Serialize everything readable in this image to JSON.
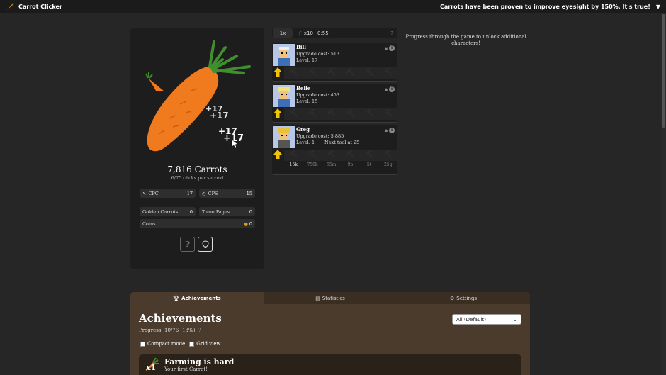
{
  "topbar": {
    "title": "Carrot Clicker",
    "tip": "Carrots have been proven to improve eyesight by 150%. It's true!"
  },
  "clicks": {
    "floating_labels": [
      "+17",
      "+17",
      "+17",
      "+17"
    ]
  },
  "main": {
    "carrot_count": "7,816 Carrots",
    "cps_line": "6/75 clicks per second",
    "stats": {
      "cpc_label": "CPC",
      "cpc_value": "17",
      "cps_label": "CPS",
      "cps_value": "15",
      "golden_label": "Golden Carrots",
      "golden_value": "0",
      "tome_label": "Tome Pages",
      "tome_value": "0",
      "coins_label": "Coins",
      "coins_value": "0"
    },
    "help_label": "?"
  },
  "toolbar": {
    "multiplier": "1x",
    "x10_label": "x10",
    "timer": "0:55",
    "help": "?"
  },
  "characters": [
    {
      "name": "Bill",
      "cost": "Upgrade cost: 513",
      "level": "Level: 17",
      "next_tool": ""
    },
    {
      "name": "Belle",
      "cost": "Upgrade cost: 453",
      "level": "Level: 15",
      "next_tool": ""
    },
    {
      "name": "Greg",
      "cost": "Upgrade cost: 5,885",
      "level": "Level: 1",
      "next_tool": "Next tool at 25"
    }
  ],
  "tool_prices": [
    "15k",
    "750k",
    "55m",
    "9b",
    "5t",
    "25q"
  ],
  "progress_note": "Progress through the game to unlock additional characters!",
  "bottom": {
    "tabs": [
      "Achievements",
      "Statistics",
      "Settings"
    ],
    "title": "Achievements",
    "progress": "Progress: 10/76 (13%)",
    "progress_help": "?",
    "filter_selected": "All (Default)",
    "compact_label": "Compact mode",
    "grid_label": "Grid view",
    "achievement": {
      "multiplier": "x1",
      "name": "Farming is hard",
      "desc": "Your first Carrot!"
    }
  },
  "colors": {
    "background": "#262626",
    "panel": "#1d1d1d",
    "bottom_panel": "#4a3b2d",
    "carrot": "#f07a1e",
    "arrow": "#f5c400"
  }
}
